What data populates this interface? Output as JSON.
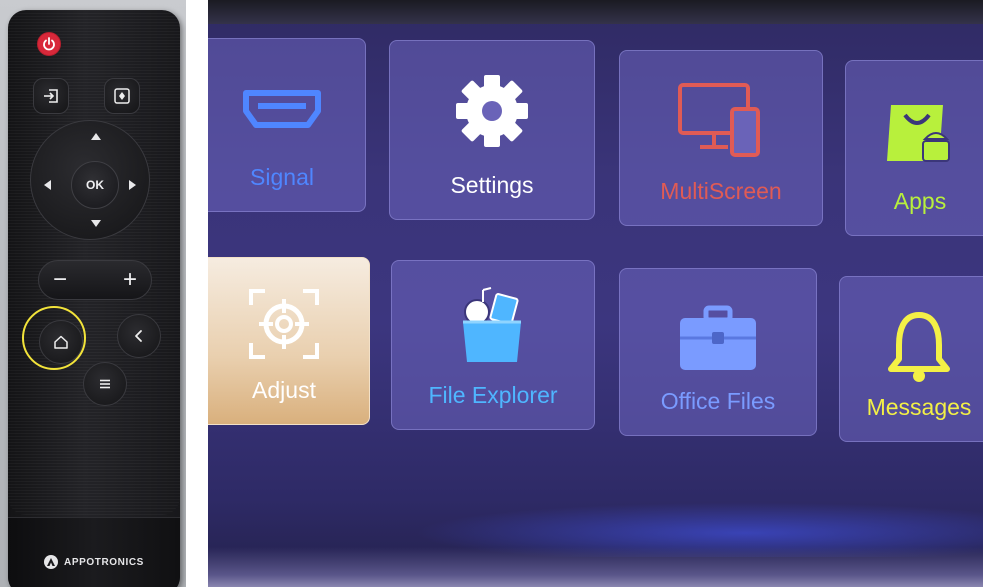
{
  "remote": {
    "ok_label": "OK",
    "minus_label": "−",
    "plus_label": "+",
    "brand": "APPOTRONICS",
    "highlight_color": "#f2e33a",
    "icons": [
      "power-icon",
      "input-source-icon",
      "focus-icon",
      "home-icon",
      "back-icon",
      "menu-icon"
    ]
  },
  "launcher": {
    "tiles": [
      {
        "label": "Signal",
        "icon": "hdmi-icon",
        "color": "#4f86ff"
      },
      {
        "label": "Settings",
        "icon": "gear-icon",
        "color": "#ffffff"
      },
      {
        "label": "MultiScreen",
        "icon": "multiscreen-icon",
        "color": "#e05b55"
      },
      {
        "label": "Apps",
        "icon": "android-bag-icon",
        "color": "#b8f03c"
      },
      {
        "label": "Adjust",
        "icon": "target-icon",
        "color": "#ffffff",
        "selected": true
      },
      {
        "label": "File Explorer",
        "icon": "folder-icon",
        "color": "#4fb6ff"
      },
      {
        "label": "Office Files",
        "icon": "briefcase-icon",
        "color": "#7a9bff"
      },
      {
        "label": "Messages",
        "icon": "bell-icon",
        "color": "#f3f046"
      }
    ]
  }
}
